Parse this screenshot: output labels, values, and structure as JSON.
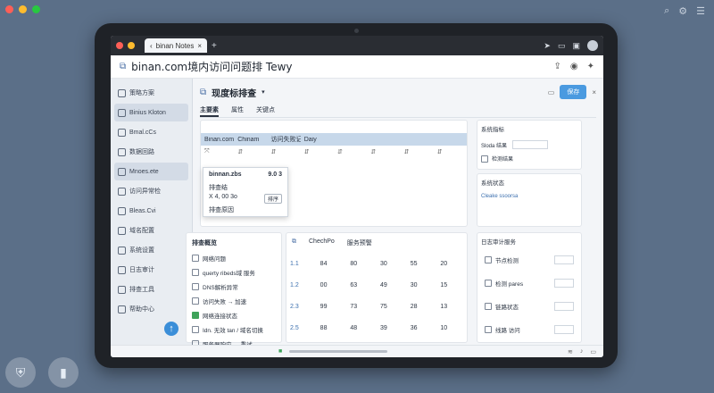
{
  "colors": {
    "accent": "#4a9ae0",
    "highlight_row": "#c7d8ea",
    "highlight_dark": "#3d5775",
    "success": "#3fa35a"
  },
  "browser": {
    "tab_title": "binan Notes",
    "address_title": "binan.com境内访问问题排 Tewy"
  },
  "sidebar": {
    "items": [
      {
        "label": "策略方案",
        "icon": "folder-icon"
      },
      {
        "label": "Binius Kloton",
        "icon": "doc-icon"
      },
      {
        "label": "Bmal.cCs",
        "icon": "mail-icon"
      },
      {
        "label": "数据回路",
        "icon": "chart-icon"
      },
      {
        "label": "Mnoes.ete",
        "icon": "note-icon"
      },
      {
        "label": "访问异常检",
        "icon": "alert-icon"
      },
      {
        "label": "Bleas.Cvi",
        "icon": "list-icon"
      },
      {
        "label": "域名配置",
        "icon": "globe-icon"
      },
      {
        "label": "系统设置",
        "icon": "gear-icon"
      },
      {
        "label": "日志审计",
        "icon": "log-icon"
      },
      {
        "label": "排查工具",
        "icon": "tool-icon"
      },
      {
        "label": "帮助中心",
        "icon": "help-icon"
      }
    ]
  },
  "main": {
    "title": "现度标排查",
    "primary_button": "保存",
    "tabs": [
      "主要素",
      "属性",
      "关键点"
    ],
    "grid_headers": [
      "Binan.com",
      "Chinam",
      "访问失败记录",
      "Daiy",
      "",
      "",
      "",
      ""
    ],
    "popup": {
      "title": "binnan.zbs",
      "code": "9.0 3",
      "subtitle": "排查结",
      "line1": "X 4, 00 3o",
      "btn": "排序",
      "line2": "排查原因"
    },
    "list_panel_title": "排查概览",
    "list_items": [
      {
        "label": "网络问题",
        "checked": false
      },
      {
        "label": "querty ribeds域 服务",
        "checked": false
      },
      {
        "label": "DNS解析异常",
        "checked": false
      },
      {
        "label": "访问失败 → 加速",
        "checked": false
      },
      {
        "label": "网络连接状态",
        "checked": true
      },
      {
        "label": "Idn. 无效 tan / 域名切换",
        "checked": false
      },
      {
        "label": "服务器响应 → 重试",
        "checked": false
      },
      {
        "label": "tesoy access logs",
        "checked": false
      }
    ],
    "table_head": [
      "ChechPo",
      "服务预警"
    ],
    "table_rows": [
      [
        "1.1",
        "84",
        "80",
        "30",
        "55",
        "20"
      ],
      [
        "1.2",
        "00",
        "63",
        "49",
        "30",
        "15"
      ],
      [
        "2.3",
        "99",
        "73",
        "75",
        "28",
        "13"
      ],
      [
        "2.5",
        "88",
        "48",
        "39",
        "36",
        "10"
      ]
    ],
    "right_top": {
      "title": "系统指标",
      "field_label": "Sloda 结果",
      "check_label": "检测结果"
    },
    "right_mid": {
      "title": "系统状态",
      "link": "Cleake ssoorsa"
    },
    "right_bottom": {
      "title": "日志审计服务",
      "rows": [
        "节点检测",
        "检测 pares",
        "链路状态",
        "线路 访问"
      ]
    }
  }
}
